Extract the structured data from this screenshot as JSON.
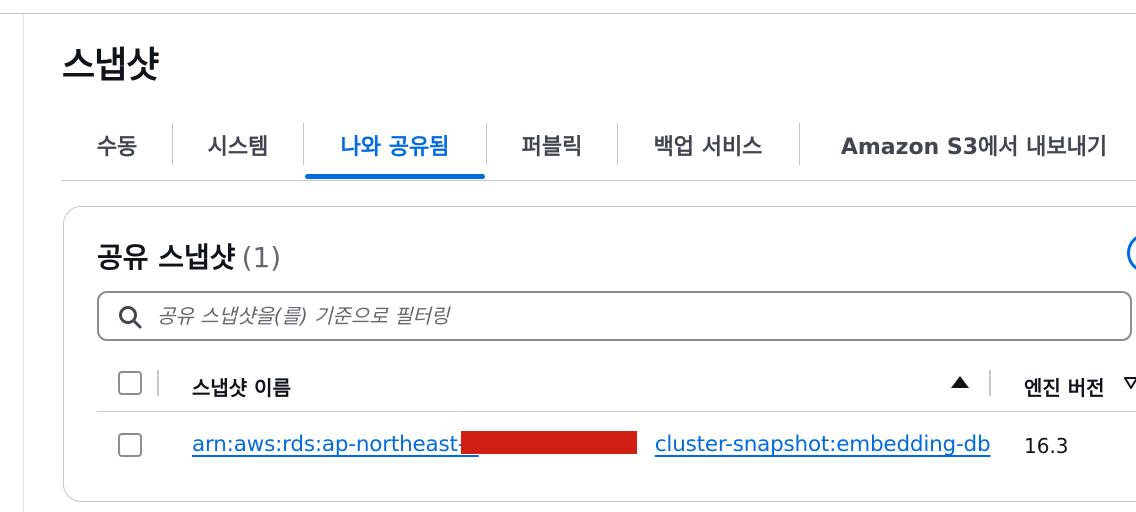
{
  "page": {
    "title": "스냅샷"
  },
  "tabs": [
    {
      "label": "수동",
      "active": false
    },
    {
      "label": "시스템",
      "active": false
    },
    {
      "label": "나와 공유됨",
      "active": true
    },
    {
      "label": "퍼블릭",
      "active": false
    },
    {
      "label": "백업 서비스",
      "active": false
    },
    {
      "label": "Amazon S3에서 내보내기",
      "active": false
    }
  ],
  "panel": {
    "title": "공유 스냅샷",
    "count": "(1)"
  },
  "search": {
    "placeholder": "공유 스냅샷을(를) 기준으로 필터링",
    "value": ""
  },
  "table": {
    "columns": [
      {
        "label": "스냅샷 이름",
        "sort": "ascending"
      },
      {
        "label": "엔진 버전",
        "sort": "none"
      }
    ],
    "rows": [
      {
        "snapshot_name": "arn:aws:rds:ap-northeast-2████████████cluster-snapshot:embedding-db",
        "snapshot_name_prefix": "arn:aws:rds:ap-northeast-2",
        "snapshot_name_suffix": "cluster-snapshot:embedding-db",
        "engine_version": "16.3",
        "selected": false
      }
    ]
  },
  "colors": {
    "accent": "#006ce0",
    "text": "#0f141a",
    "muted": "#424650",
    "border": "#c6c6cd",
    "redaction": "#d21f14"
  },
  "icons": {
    "search": "search-icon",
    "sort_ascending": "sort-ascending-icon",
    "sort_descending": "sort-descending-icon"
  }
}
